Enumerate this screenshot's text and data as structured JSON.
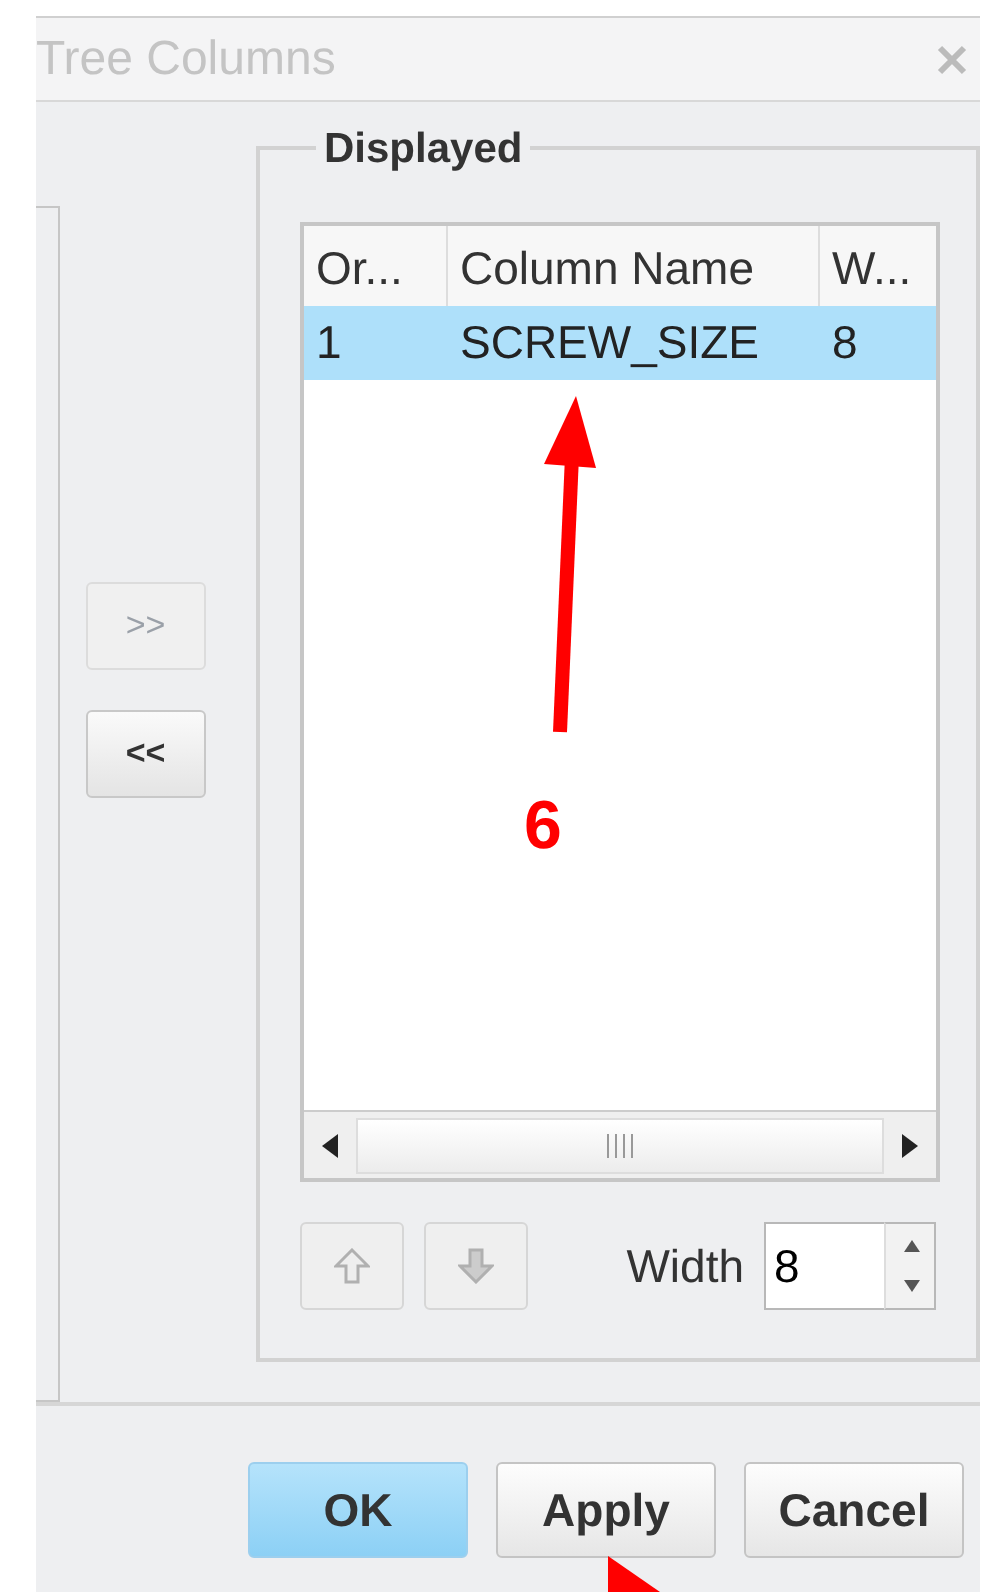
{
  "window": {
    "title": "Tree Columns"
  },
  "move_buttons": [
    {
      "label": ">>",
      "disabled": true
    },
    {
      "label": "<<",
      "disabled": false
    }
  ],
  "displayed": {
    "legend": "Displayed",
    "columns": [
      "Or...",
      "Column Name",
      "W..."
    ],
    "rows": [
      {
        "cells": [
          "1",
          "SCREW_SIZE",
          "8"
        ],
        "selected": true
      }
    ]
  },
  "order_buttons": [
    {
      "kind": "up",
      "disabled": true
    },
    {
      "kind": "down",
      "disabled": true
    }
  ],
  "width": {
    "label": "Width",
    "value": "8"
  },
  "buttons": [
    {
      "label": "OK",
      "default": true
    },
    {
      "label": "Apply",
      "default": false
    },
    {
      "label": "Cancel",
      "default": false
    }
  ],
  "annotation": {
    "label": "6"
  }
}
